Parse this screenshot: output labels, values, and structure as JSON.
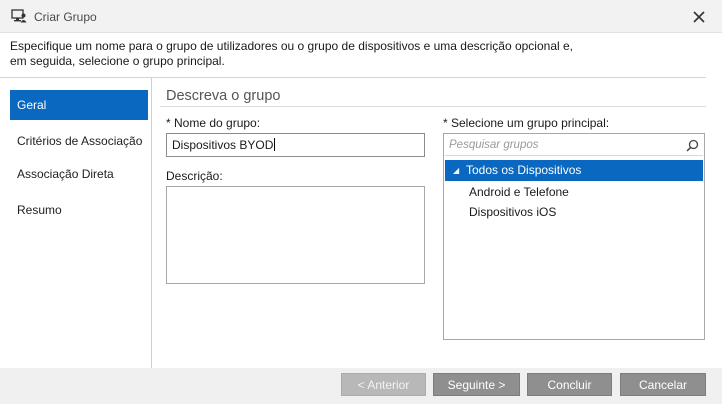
{
  "window": {
    "title": "Criar Grupo"
  },
  "intro": {
    "line1": "Especifique um nome para o grupo de utilizadores ou o grupo de dispositivos e uma descrição opcional e,",
    "line2": "em seguida, selecione o grupo principal."
  },
  "nav": {
    "items": [
      {
        "label": "Geral",
        "active": true
      },
      {
        "label": "Critérios de Associação",
        "active": false
      },
      {
        "label": "Associação Direta",
        "active": false
      },
      {
        "label": "Resumo",
        "active": false
      }
    ]
  },
  "form": {
    "section_title": "Descreva o grupo",
    "name_label": "* Nome do grupo:",
    "name_value": "Dispositivos BYOD",
    "description_label": "Descrição:",
    "description_value": "",
    "parent_label": "* Selecione um grupo principal:",
    "search_placeholder": "Pesquisar grupos"
  },
  "tree": {
    "root": {
      "label": "Todos os Dispositivos",
      "expanded": true,
      "selected": true
    },
    "children": [
      {
        "label": "Android e Telefone"
      },
      {
        "label": "Dispositivos iOS"
      }
    ]
  },
  "buttons": {
    "back": "< Anterior",
    "next": "Seguinte >",
    "finish": "Concluir",
    "cancel": "Cancelar"
  },
  "icons": {
    "app": "users-computer-icon",
    "close": "close-icon",
    "search": "search-icon",
    "expand": "triangle-expanded-icon"
  },
  "colors": {
    "accent": "#0a68c0",
    "button": "#8f8f8f",
    "button_disabled": "#b8b8b8"
  }
}
